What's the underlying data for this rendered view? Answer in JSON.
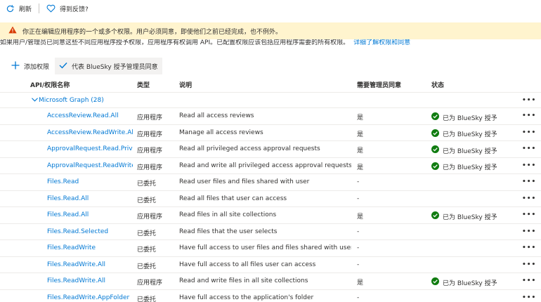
{
  "toolbar": {
    "refresh_label": "刷新",
    "feedback_label": "得到反馈?"
  },
  "banner": {
    "message": "你正在编辑应用程序的一个或多个权限。用户必须同意，即使他们之前已经完成，也不例外。"
  },
  "description": {
    "text": "如果用户/管理员已同意这些不同应用程序授予权限，应用程序有权调用 API。已配置权限应该包括应用程序需要的所有权限。",
    "link": "详细了解权限和同意"
  },
  "actions": {
    "add_label": "添加权限",
    "consent_label": "代表 BlueSky 授予管理员同意"
  },
  "table": {
    "headers": [
      "API/权限名称",
      "类型",
      "说明",
      "需要管理员同意",
      "状态"
    ],
    "group_label": "Microsoft Graph (28)",
    "more_label": "•••",
    "rows": [
      {
        "name": "AccessReview.Read.All",
        "type": "应用程序",
        "desc": "Read all access reviews",
        "admin": "是",
        "status": "已为 BlueSky 授予"
      },
      {
        "name": "AccessReview.ReadWrite.All",
        "type": "应用程序",
        "desc": "Manage all access reviews",
        "admin": "是",
        "status": "已为 BlueSky 授予"
      },
      {
        "name": "ApprovalRequest.Read.PrivilegedAccess",
        "type": "应用程序",
        "desc": "Read all privileged access approval requests",
        "admin": "是",
        "status": "已为 BlueSky 授予"
      },
      {
        "name": "ApprovalRequest.ReadWrite.PrivilegedAccess",
        "type": "应用程序",
        "desc": "Read and write all privileged access approval requests",
        "admin": "是",
        "status": "已为 BlueSky 授予"
      },
      {
        "name": "Files.Read",
        "type": "已委托",
        "desc": "Read user files and files shared with user",
        "admin": "-",
        "status": ""
      },
      {
        "name": "Files.Read.All",
        "type": "已委托",
        "desc": "Read all files that user can access",
        "admin": "-",
        "status": ""
      },
      {
        "name": "Files.Read.All",
        "type": "应用程序",
        "desc": "Read files in all site collections",
        "admin": "是",
        "status": "已为 BlueSky 授予"
      },
      {
        "name": "Files.Read.Selected",
        "type": "已委托",
        "desc": "Read files that the user selects",
        "admin": "-",
        "status": ""
      },
      {
        "name": "Files.ReadWrite",
        "type": "已委托",
        "desc": "Have full access to user files and files shared with user",
        "admin": "-",
        "status": ""
      },
      {
        "name": "Files.ReadWrite.All",
        "type": "已委托",
        "desc": "Have full access to all files user can access",
        "admin": "-",
        "status": ""
      },
      {
        "name": "Files.ReadWrite.All",
        "type": "应用程序",
        "desc": "Read and write files in all site collections",
        "admin": "是",
        "status": "已为 BlueSky 授予"
      },
      {
        "name": "Files.ReadWrite.AppFolder",
        "type": "已委托",
        "desc": "Have full access to the application's folder",
        "admin": "-",
        "status": ""
      }
    ]
  },
  "colors": {
    "link": "#0078d4",
    "warning_bg": "#fff4ce",
    "warning_icon": "#d83b01",
    "granted": "#107c10"
  }
}
